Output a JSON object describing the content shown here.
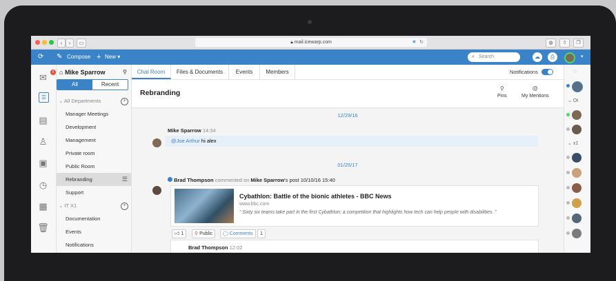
{
  "browser": {
    "url": "mail.icewarp.com",
    "nav_back": "‹",
    "nav_forward": "›"
  },
  "toolbar": {
    "compose_label": "Compose",
    "new_label": "New ▾",
    "search_placeholder": "Search"
  },
  "rail": {
    "mail_badge": "5"
  },
  "sidebar": {
    "user_name": "Mike Sparrow",
    "seg_all": "All",
    "seg_recent": "Recent",
    "group1": "All Departments",
    "items1": [
      "Manager Meetings",
      "Development",
      "Management",
      "Private room",
      "Public Room",
      "Rebranding",
      "Support"
    ],
    "group2": "IT X1",
    "items2": [
      "Documentation",
      "Events",
      "Notifications"
    ]
  },
  "tabs": [
    "Chat Room",
    "Files & Documents",
    "Events",
    "Members"
  ],
  "notifications_label": "Notifications",
  "room": {
    "title": "Rebranding",
    "pins_label": "Pins",
    "mentions_label": "My Mentions"
  },
  "feed": {
    "date1": "12/29/16",
    "msg1_author": "Mike Sparrow",
    "msg1_time": "14:34",
    "msg1_mention": "@Joe Arthur",
    "msg1_text": "hi alex",
    "date2": "01/25/17",
    "post_author": "Brad Thompson",
    "post_mid": "commented on",
    "post_target": "Mike Sparrow",
    "post_suffix": "'s post",
    "post_time": "10/10/16 15:40",
    "card_title": "Cybathlon: Battle of the bionic athletes - BBC News",
    "card_source": "www.bbc.com",
    "card_quote": "“ Sixty six teams take part in the first Cybathlon: a competition that highlights how tech can help people with disabilities. ”",
    "likes": "1",
    "public_label": "Public",
    "comments_label": "Comments",
    "comments_count": "1",
    "reply_author": "Brad Thompson",
    "reply_time": "12:02"
  },
  "rrail": {
    "group1": "Ot",
    "group2": "x1"
  },
  "colors": {
    "accent": "#3b83c8",
    "badge": "#e74c3c"
  }
}
